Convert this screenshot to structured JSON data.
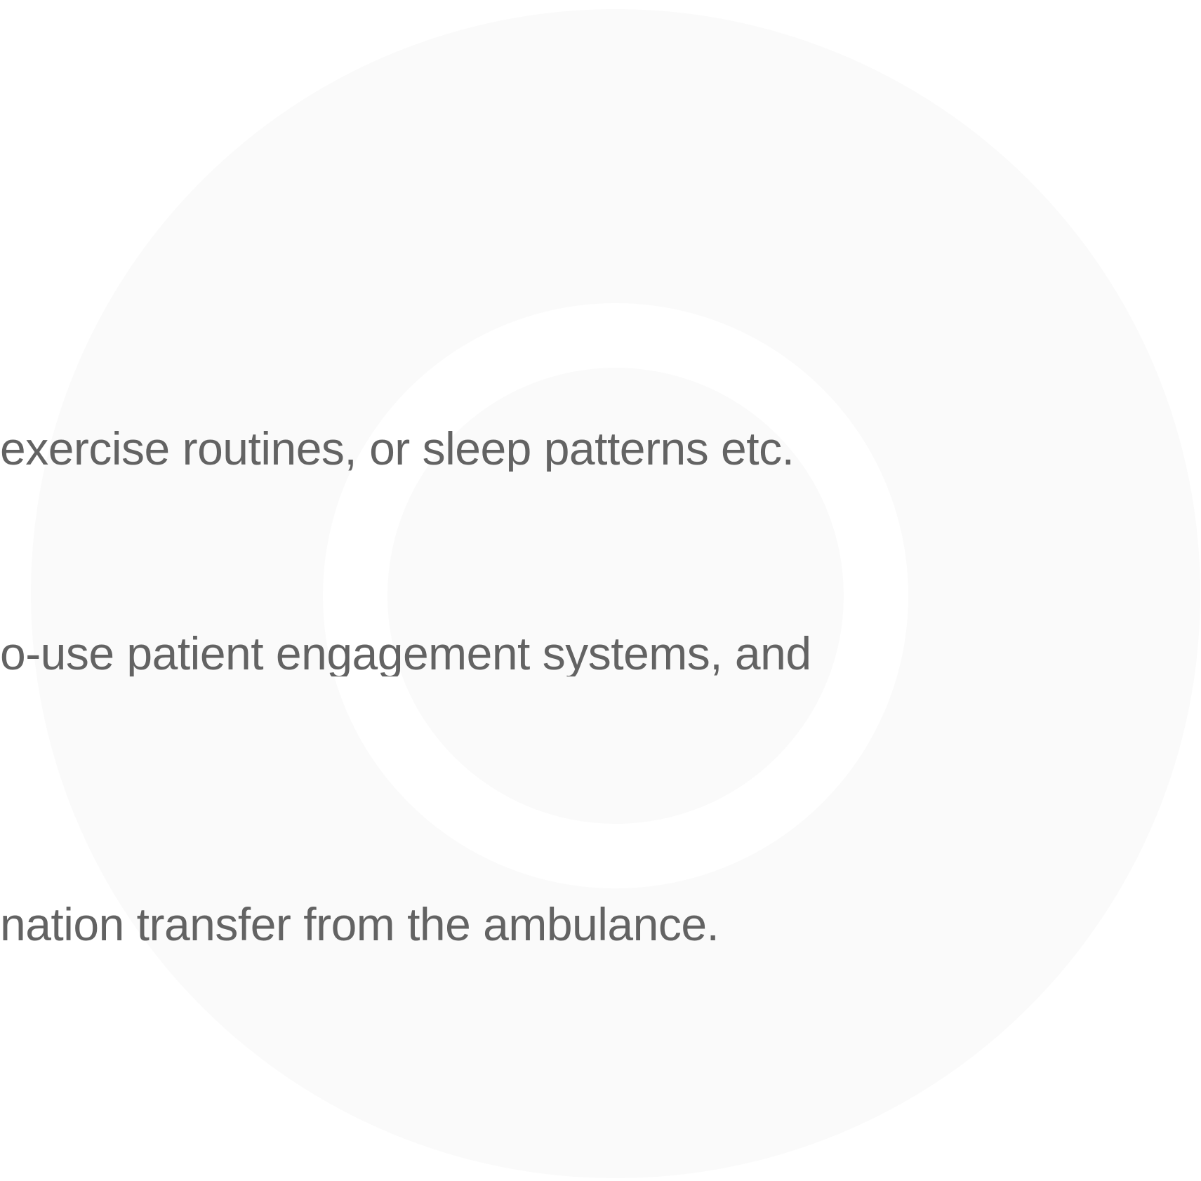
{
  "content": {
    "lines": [
      "exercise routines, or sleep patterns etc.",
      "o-use patient engagement systems, and",
      "nation transfer from the ambulance."
    ]
  },
  "colors": {
    "background": "#ffffff",
    "circle_fill": "#fafafa",
    "text": "#636363"
  }
}
